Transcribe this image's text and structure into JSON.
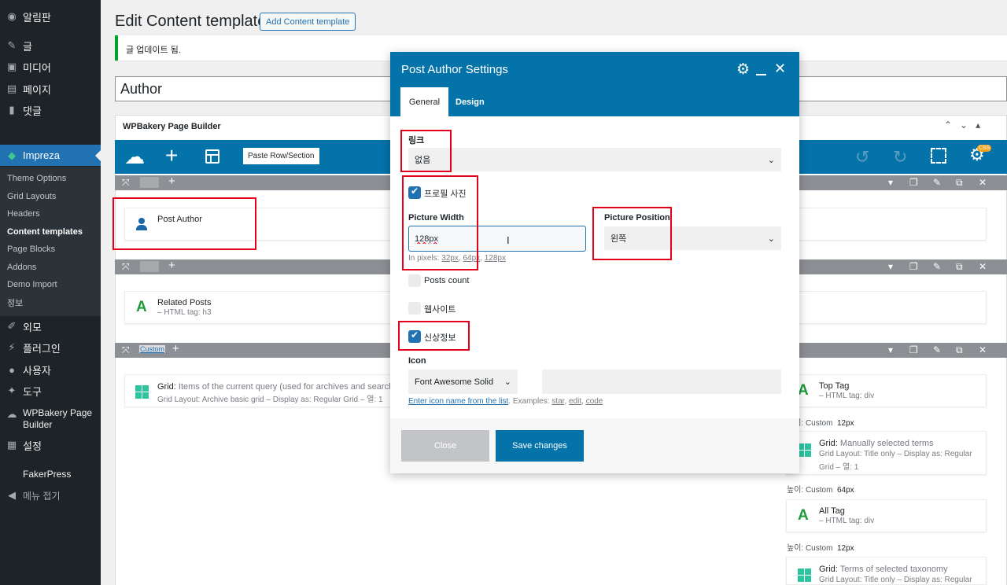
{
  "sidebar": {
    "items": [
      {
        "label": "알림판",
        "icon": "dashboard-icon"
      },
      {
        "label": "글",
        "icon": "pin-icon"
      },
      {
        "label": "미디어",
        "icon": "media-icon"
      },
      {
        "label": "페이지",
        "icon": "page-icon"
      },
      {
        "label": "댓글",
        "icon": "comment-icon"
      },
      {
        "label": "Impreza",
        "icon": "impreza-icon"
      },
      {
        "label": "외모",
        "icon": "brush-icon"
      },
      {
        "label": "플러그인",
        "icon": "plugin-icon"
      },
      {
        "label": "사용자",
        "icon": "user-icon"
      },
      {
        "label": "도구",
        "icon": "wrench-icon"
      },
      {
        "label": "WPBakery Page Builder",
        "icon": "wpbakery-icon"
      },
      {
        "label": "설정",
        "icon": "settings-icon"
      },
      {
        "label": "FakerPress",
        "icon": ""
      },
      {
        "label": "메뉴 접기",
        "icon": "collapse-icon"
      }
    ],
    "submenu": [
      "Theme Options",
      "Grid Layouts",
      "Headers",
      "Content templates",
      "Page Blocks",
      "Addons",
      "Demo Import",
      "정보"
    ]
  },
  "header": {
    "title": "Edit Content template",
    "add_button": "Add Content template"
  },
  "notice": "글 업데이트 됨.",
  "post_title": "Author",
  "builder": {
    "title": "WPBakery Page Builder",
    "paste_label": "Paste Row/Section",
    "css_badge": "CSS",
    "elements": {
      "post_author": "Post Author",
      "related_posts": "Related Posts",
      "related_posts_sub": "– HTML tag: h3",
      "custom_label": "Custom",
      "grid_label": "Grid:",
      "grid_desc": "Items of the current query (used for archives and search res",
      "grid_sub": "Grid Layout: Archive basic grid – Display as: Regular Grid – 열: 1",
      "top_tag": "Top Tag",
      "top_tag_sub": "– HTML tag: div",
      "height1": "높이: Custom",
      "height1_val": "12px",
      "grid2_label": "Grid:",
      "grid2_desc": "Manually selected terms",
      "grid2_sub": "Grid Layout: Title only – Display as: Regular",
      "grid2_sub2": "Grid – 열: 1",
      "height2": "높이: Custom",
      "height2_val": "64px",
      "all_tag": "All Tag",
      "all_tag_sub": "– HTML tag: div",
      "height3": "높이: Custom",
      "height3_val": "12px",
      "grid3_label": "Grid:",
      "grid3_desc": "Terms of selected taxonomy",
      "grid3_sub": "Grid Layout: Title only – Display as: Regular"
    }
  },
  "modal": {
    "title": "Post Author Settings",
    "tabs": [
      "General",
      "Design"
    ],
    "link_label": "링크",
    "link_value": "없음",
    "avatar_label": "프로필 사진",
    "picture_width_label": "Picture Width",
    "picture_width_value": "128px",
    "picture_width_hint": "In pixels:",
    "hint_sizes": [
      "32px",
      "64px",
      "128px"
    ],
    "picture_position_label": "Picture Position",
    "picture_position_value": "왼쪽",
    "posts_count_label": "Posts count",
    "website_label": "웹사이트",
    "info_label": "신상정보",
    "icon_label": "Icon",
    "icon_font_value": "Font Awesome Solid",
    "icon_hint_link": "Enter icon name from the list",
    "icon_hint_rest": ". Examples:",
    "icon_examples": [
      "star",
      "edit",
      "code"
    ],
    "close_button": "Close",
    "save_button": "Save changes"
  },
  "colors": {
    "accent": "#0473aa",
    "wp_blue": "#2271b1",
    "highlight": "#e2001a",
    "success": "#00a32a"
  }
}
